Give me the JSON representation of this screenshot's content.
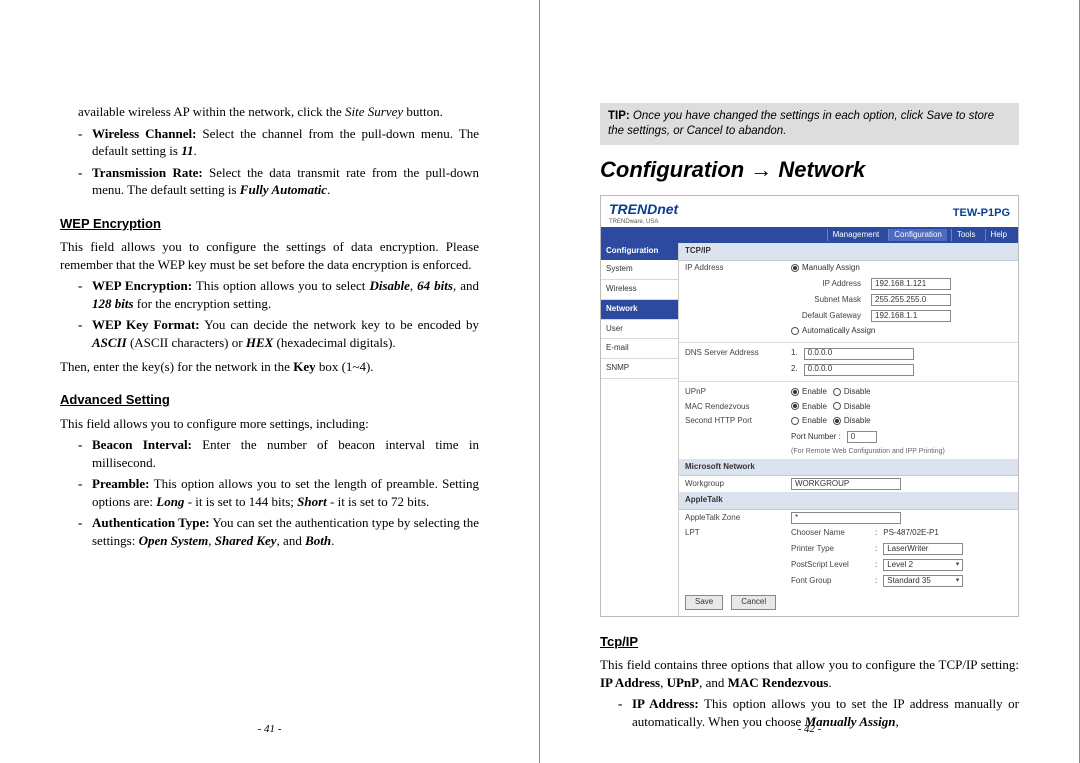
{
  "left": {
    "intro_text": "available wireless AP within the network, click the ",
    "intro_italic": "Site Survey",
    "intro_after": " button.",
    "wireless_channel_label": "Wireless Channel:",
    "wireless_channel_text": " Select the channel from the pull-down menu. The default setting is ",
    "wireless_channel_default": "11",
    "trans_rate_label": "Transmission Rate:",
    "trans_rate_text": " Select the data transmit rate from the pull-down menu.    The default setting is ",
    "trans_rate_default": "Fully Automatic",
    "wep_heading": "WEP Encryption",
    "wep_intro": "This field allows you to configure the settings of data encryption. Please remember that the WEP key must be set before the data encryption is enforced.",
    "wep_enc_label": "WEP Encryption:",
    "wep_enc_text_a": " This option allows you to select ",
    "wep_enc_disable": "Disable",
    "wep_enc_64": "64 bits",
    "wep_enc_and": ", and ",
    "wep_enc_128": "128 bits",
    "wep_enc_tail": " for the encryption setting.",
    "wep_key_label": "WEP Key Format:",
    "wep_key_text_a": " You can decide the network key to be encoded by ",
    "wep_key_ascii": "ASCII",
    "wep_key_mid": " (ASCII characters) or ",
    "wep_key_hex": "HEX",
    "wep_key_tail": " (hexadecimal digitals).",
    "then_enter_a": "Then, enter the key(s) for the network in the ",
    "then_enter_key": "Key",
    "then_enter_b": " box (1~4).",
    "adv_heading": "Advanced Setting",
    "adv_intro": "This field allows you to configure more settings, including:",
    "beacon_label": "Beacon Interval:",
    "beacon_text": " Enter the number of beacon interval time in millisecond.",
    "preamble_label": "Preamble:",
    "preamble_text_a": " This option allows you to set the length of preamble. Setting options are: ",
    "preamble_long": "Long",
    "preamble_mid1": " - it is set to 144 bits; ",
    "preamble_short": "Short",
    "preamble_mid2": " - it is set to 72 bits.",
    "auth_label": "Authentication Type:",
    "auth_text_a": " You can set the authentication type by selecting the settings: ",
    "auth_open": "Open System",
    "auth_shared": "Shared Key",
    "auth_both": "Both",
    "pagenum": "- 41 -"
  },
  "right": {
    "tip_label": "TIP:",
    "tip_text_a": " Once you have changed the settings in each option, click ",
    "tip_save": "Save",
    "tip_text_b": " to store the settings, or ",
    "tip_cancel": "Cancel",
    "tip_text_c": " to abandon.",
    "main_heading": "Configuration → Network",
    "shot": {
      "brand": "TRENDnet",
      "brand_sub": "TRENDware, USA",
      "model": "TEW-P1PG",
      "tabs": [
        "Management",
        "Configuration",
        "Tools",
        "Help"
      ],
      "sidebar_header": "Configuration",
      "sidebar_items": [
        "System",
        "Wireless",
        "Network",
        "User",
        "E-mail",
        "SNMP"
      ],
      "tcpip_header": "TCP/IP",
      "ip_address_label": "IP Address",
      "manually_assign": "Manually Assign",
      "ip_addr_sub": "IP Address",
      "ip_addr_val": "192.168.1.121",
      "subnet_sub": "Subnet Mask",
      "subnet_val": "255.255.255.0",
      "gateway_sub": "Default Gateway",
      "gateway_val": "192.168.1.1",
      "auto_assign": "Automatically Assign",
      "dns_label": "DNS Server Address",
      "dns1_prefix": "1.",
      "dns1_val": "0.0.0.0",
      "dns2_prefix": "2.",
      "dns2_val": "0.0.0.0",
      "upnp_label": "UPnP",
      "enable": "Enable",
      "disable": "Disable",
      "mac_rv_label": "MAC Rendezvous",
      "second_http_label": "Second HTTP Port",
      "port_number_label": "Port Number :",
      "port_number_val": "0",
      "port_note": "(For Remote Web Configuration and IPP Printing)",
      "ms_header": "Microsoft Network",
      "workgroup_label": "Workgroup",
      "workgroup_val": "WORKGROUP",
      "apple_header": "AppleTalk",
      "apple_zone_label": "AppleTalk Zone",
      "apple_zone_val": "*",
      "lpt_label": "LPT",
      "chooser_label": "Chooser Name",
      "chooser_val": "PS-487/02E-P1",
      "printer_type_label": "Printer Type",
      "printer_type_val": "LaserWriter",
      "ps_level_label": "PostScript Level",
      "ps_level_val": "Level 2",
      "font_group_label": "Font Group",
      "font_group_val": "Standard 35",
      "save_btn": "Save",
      "cancel_btn": "Cancel"
    },
    "tcpip_heading": "Tcp/IP",
    "tcpip_intro_a": "This field contains three options that allow you to configure the TCP/IP setting: ",
    "tcpip_ip": "IP Address",
    "tcpip_upnp": "UPnP",
    "tcpip_mac": "MAC Rendezvous",
    "ip_addr_label": "IP Address:",
    "ip_addr_text_a": " This option allows you to set the IP address manually or automatically.    When you choose ",
    "ip_addr_manual": "Manually Assign",
    "pagenum": "- 42 -"
  }
}
